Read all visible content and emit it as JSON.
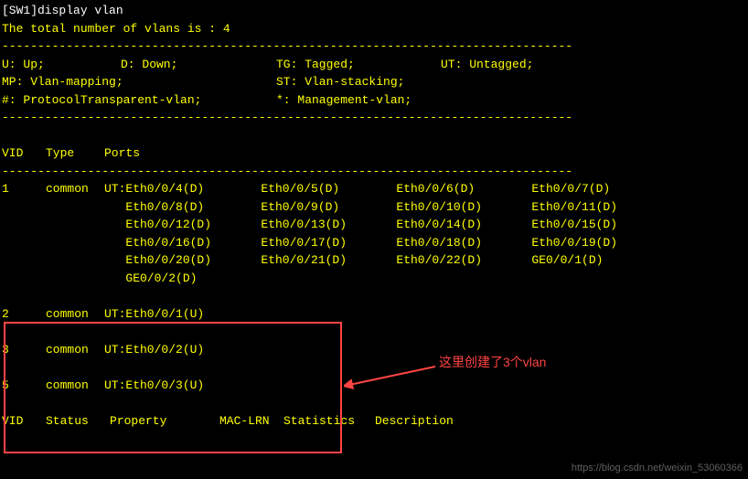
{
  "prompt": "[SW1]display vlan",
  "total_line": "The total number of vlans is : 4",
  "legend": {
    "u": "U: Up;",
    "d": "D: Down;",
    "tg": "TG: Tagged;",
    "ut": "UT: Untagged;",
    "mp": "MP: Vlan-mapping;",
    "st": "ST: Vlan-stacking;",
    "hash": "#: ProtocolTransparent-vlan;",
    "star": "*: Management-vlan;"
  },
  "headers": {
    "vid": "VID",
    "type": "Type",
    "ports": "Ports",
    "status": "Status",
    "property": "Property",
    "maclrn": "MAC-LRN",
    "stats": "Statistics",
    "desc": "Description"
  },
  "dash": "--------------------------------------------------------------------------------",
  "vlans": [
    {
      "vid": "1",
      "type": "common",
      "prefix": "UT:",
      "ports": [
        "Eth0/0/4(D)",
        "Eth0/0/5(D)",
        "Eth0/0/6(D)",
        "Eth0/0/7(D)",
        "Eth0/0/8(D)",
        "Eth0/0/9(D)",
        "Eth0/0/10(D)",
        "Eth0/0/11(D)",
        "Eth0/0/12(D)",
        "Eth0/0/13(D)",
        "Eth0/0/14(D)",
        "Eth0/0/15(D)",
        "Eth0/0/16(D)",
        "Eth0/0/17(D)",
        "Eth0/0/18(D)",
        "Eth0/0/19(D)",
        "Eth0/0/20(D)",
        "Eth0/0/21(D)",
        "Eth0/0/22(D)",
        "GE0/0/1(D)",
        "GE0/0/2(D)"
      ]
    },
    {
      "vid": "2",
      "type": "common",
      "prefix": "UT:",
      "ports": [
        "Eth0/0/1(U)"
      ]
    },
    {
      "vid": "3",
      "type": "common",
      "prefix": "UT:",
      "ports": [
        "Eth0/0/2(U)"
      ]
    },
    {
      "vid": "5",
      "type": "common",
      "prefix": "UT:",
      "ports": [
        "Eth0/0/3(U)"
      ]
    }
  ],
  "annotation_text": "这里创建了3个vlan",
  "watermark": "https://blog.csdn.net/weixin_53060366"
}
